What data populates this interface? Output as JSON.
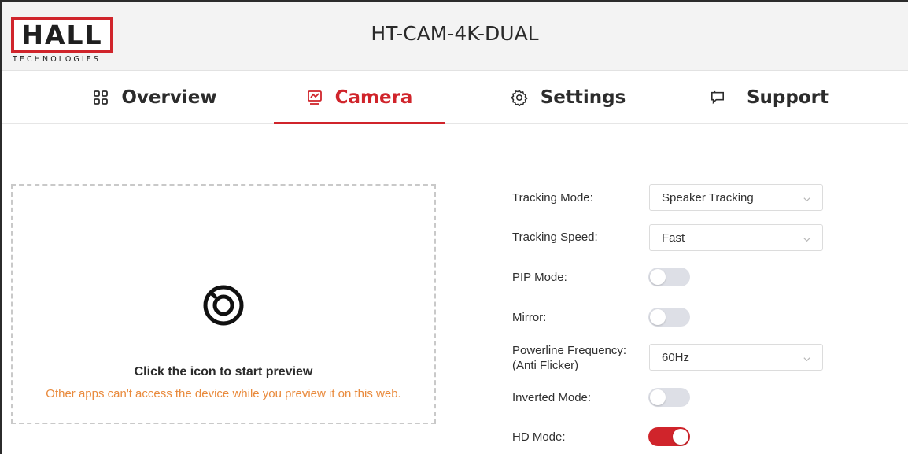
{
  "header": {
    "logo_main": "HALL",
    "logo_sub": "TECHNOLOGIES",
    "device_title": "HT-CAM-4K-DUAL"
  },
  "nav": {
    "tabs": [
      {
        "label": "Overview",
        "icon": "grid-icon",
        "active": false
      },
      {
        "label": "Camera",
        "icon": "monitor-icon",
        "active": true
      },
      {
        "label": "Settings",
        "icon": "gear-icon",
        "active": false
      },
      {
        "label": "Support",
        "icon": "chat-icon",
        "active": false
      }
    ]
  },
  "preview": {
    "icon": "preview-lens-icon",
    "title": "Click the icon to start preview",
    "note": "Other apps can't access the device while you preview it on this web."
  },
  "settings": {
    "tracking_mode": {
      "label": "Tracking Mode:",
      "value": "Speaker Tracking"
    },
    "tracking_speed": {
      "label": "Tracking Speed:",
      "value": "Fast"
    },
    "pip_mode": {
      "label": "PIP Mode:",
      "on": false
    },
    "mirror": {
      "label": "Mirror:",
      "on": false
    },
    "powerline_frequency": {
      "label_line1": "Powerline Frequency:",
      "label_line2": "(Anti Flicker)",
      "value": "60Hz"
    },
    "inverted_mode": {
      "label": "Inverted Mode:",
      "on": false
    },
    "hd_mode": {
      "label": "HD Mode:",
      "on": true
    }
  },
  "colors": {
    "accent": "#d0242b",
    "note": "#e98a3c",
    "toggle_off": "#dddfe6"
  }
}
